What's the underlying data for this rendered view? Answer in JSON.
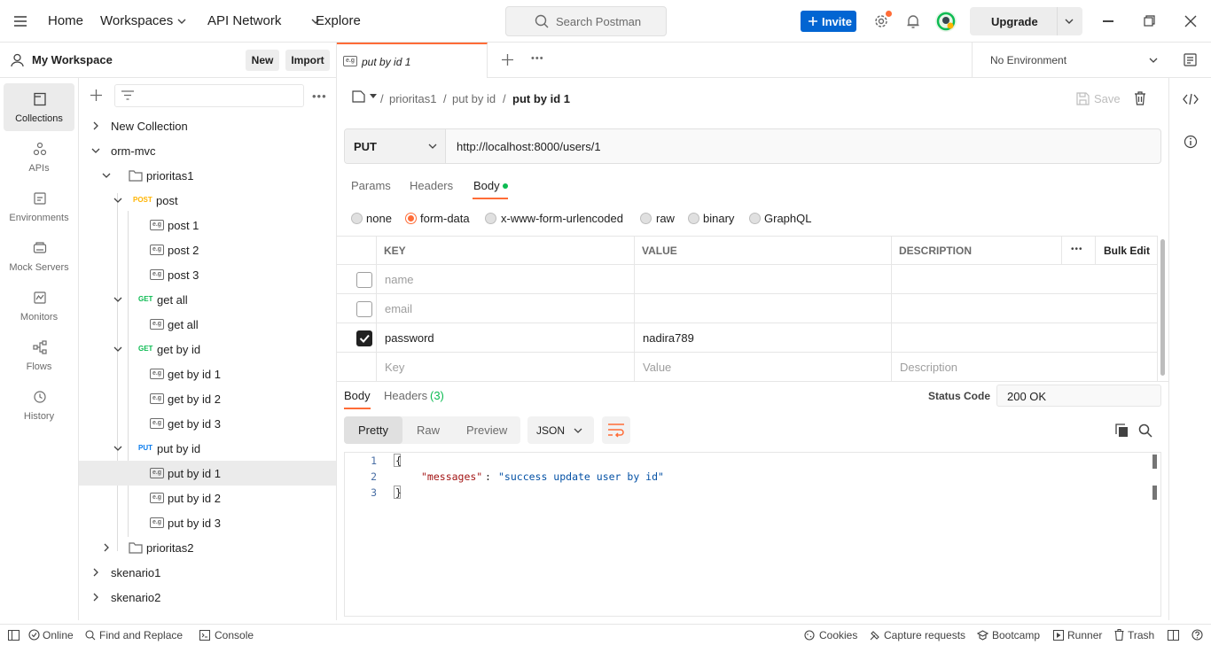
{
  "nav": {
    "home": "Home",
    "workspaces": "Workspaces",
    "api_network": "API Network",
    "explore": "Explore"
  },
  "search": {
    "placeholder": "Search Postman"
  },
  "header": {
    "invite": "Invite",
    "upgrade": "Upgrade"
  },
  "workspace": {
    "name": "My Workspace",
    "new": "New",
    "import": "Import"
  },
  "rail": [
    "Collections",
    "APIs",
    "Environments",
    "Mock Servers",
    "Monitors",
    "Flows",
    "History"
  ],
  "tree": [
    {
      "label": "New Collection"
    },
    {
      "label": "orm-mvc"
    },
    {
      "label": "prioritas1"
    },
    {
      "method": "POST",
      "label": "post"
    },
    {
      "label": "post 1"
    },
    {
      "label": "post 2"
    },
    {
      "label": "post 3"
    },
    {
      "method": "GET",
      "label": "get all"
    },
    {
      "label": "get all"
    },
    {
      "method": "GET",
      "label": "get by id"
    },
    {
      "label": "get by id 1"
    },
    {
      "label": "get by id 2"
    },
    {
      "label": "get by id 3"
    },
    {
      "method": "PUT",
      "label": "put by id"
    },
    {
      "label": "put by id 1"
    },
    {
      "label": "put by id 2"
    },
    {
      "label": "put by id 3"
    },
    {
      "label": "prioritas2"
    },
    {
      "label": "skenario1"
    },
    {
      "label": "skenario2"
    }
  ],
  "tab": {
    "title": "put by id 1",
    "badge": "e.g"
  },
  "environment": "No Environment",
  "breadcrumb": {
    "part1": "prioritas1",
    "part2": "put by id",
    "current": "put by id 1",
    "save": "Save"
  },
  "request": {
    "method": "PUT",
    "url": "http://localhost:8000/users/1"
  },
  "subtabs": {
    "params": "Params",
    "headers": "Headers",
    "body": "Body"
  },
  "body_types": [
    "none",
    "form-data",
    "x-www-form-urlencoded",
    "raw",
    "binary",
    "GraphQL"
  ],
  "table": {
    "headers": {
      "key": "KEY",
      "value": "VALUE",
      "description": "DESCRIPTION",
      "bulk": "Bulk Edit"
    },
    "rows": [
      {
        "key": "name",
        "value": "",
        "checked": false
      },
      {
        "key": "email",
        "value": "",
        "checked": false
      },
      {
        "key": "password",
        "value": "nadira789",
        "checked": true
      }
    ],
    "placeholder": {
      "key": "Key",
      "value": "Value",
      "description": "Description"
    }
  },
  "response": {
    "body_tab": "Body",
    "headers_tab": "Headers",
    "headers_count": "(3)",
    "status_label": "Status Code",
    "status_value": "200 OK",
    "views": [
      "Pretty",
      "Raw",
      "Preview"
    ],
    "format": "JSON",
    "lines": [
      "1",
      "2",
      "3"
    ],
    "open_brace": "{",
    "key": "\"messages\"",
    "colon": ": ",
    "value": "\"success update user by id\"",
    "close_brace": "}"
  },
  "statusbar": {
    "online": "Online",
    "find": "Find and Replace",
    "console": "Console",
    "cookies": "Cookies",
    "capture": "Capture requests",
    "bootcamp": "Bootcamp",
    "runner": "Runner",
    "trash": "Trash"
  },
  "colors": {
    "accent": "#ff6c37",
    "invite": "#0265d2",
    "post": "#ffb400",
    "get": "#0cbb52",
    "put": "#097bed"
  }
}
